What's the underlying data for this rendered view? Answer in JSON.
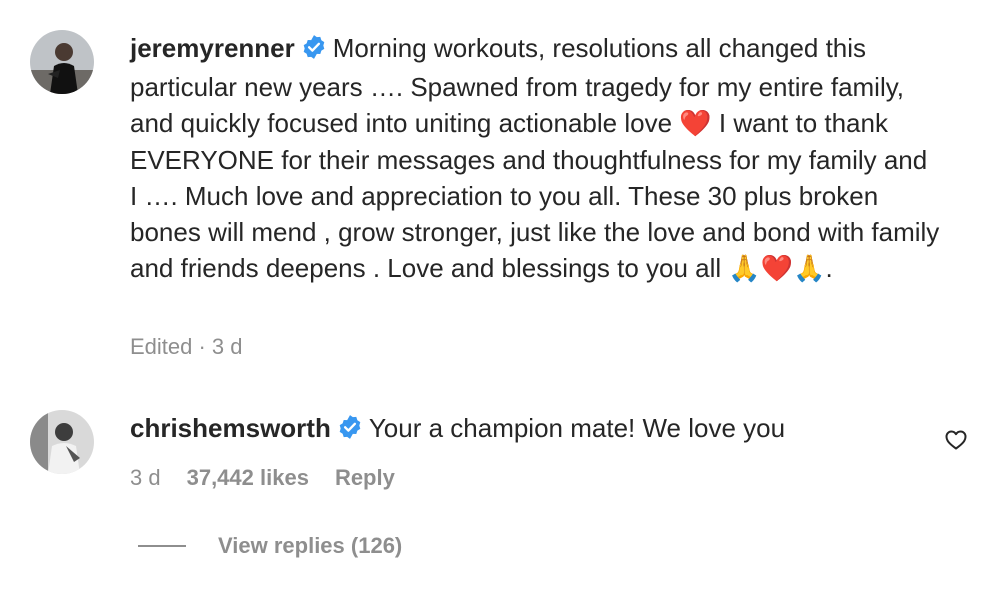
{
  "comments": [
    {
      "username": "jeremyrenner",
      "verified": true,
      "text": "Morning workouts, resolutions all changed this particular new years …. Spawned from tragedy for my entire family, and quickly focused into uniting actionable love",
      "text_2": "I want to thank EVERYONE for their messages and thoughtfulness for my family and I …. Much love and appreciation to you all. These 30 plus broken bones will mend , grow stronger, just like the love and bond with family and friends deepens . Love and blessings to you all",
      "emoji_heart": "❤️",
      "emoji_end": "🙏❤️🙏",
      "text_end": ".",
      "meta": "Edited · 3 d"
    },
    {
      "username": "chrishemsworth",
      "verified": true,
      "text": "Your a champion mate! We love you",
      "time": "3 d",
      "likes": "37,442 likes",
      "reply": "Reply",
      "view_replies": "View replies (126)"
    }
  ],
  "colors": {
    "verified": "#3897f0",
    "muted": "#8e8e8e",
    "text": "#262626"
  }
}
